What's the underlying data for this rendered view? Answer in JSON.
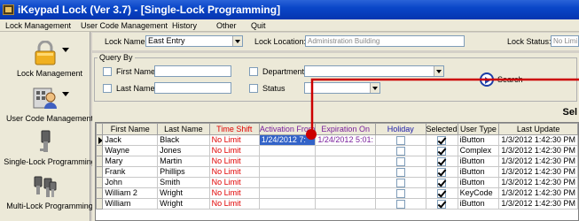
{
  "window": {
    "title": "iKeypad Lock (Ver 3.7) - [Single-Lock Programming]"
  },
  "menu": [
    "Lock Management",
    "User Code Management",
    "History",
    "Other",
    "Quit"
  ],
  "sidebar": {
    "items": [
      {
        "label": "Lock Management",
        "icon": "padlock-icon"
      },
      {
        "label": "User Code Management",
        "icon": "user-keypad-icon"
      },
      {
        "label": "Single-Lock Programming",
        "icon": "single-key-icon"
      },
      {
        "label": "Multi-Lock Programming",
        "icon": "multi-key-icon"
      }
    ]
  },
  "toprow": {
    "lock_name_label": "Lock Name:",
    "lock_name_value": "East Entry",
    "lock_location_label": "Lock Location:",
    "lock_location_value": "Administration Building",
    "lock_status_label": "Lock Status:",
    "lock_status_value": "No Limi"
  },
  "query": {
    "legend": "Query By",
    "first_name_label": "First Name",
    "last_name_label": "Last Name",
    "department_label": "Department",
    "status_label": "Status",
    "search_label": "Search"
  },
  "grid": {
    "caption": "Sel",
    "columns": [
      "First Name",
      "Last Name",
      "Time Shift",
      "Activation From",
      "Expiration On",
      "Holiday",
      "Selected",
      "User Type",
      "Last Update"
    ],
    "rows": [
      {
        "first": "Jack",
        "last": "Black",
        "shift": "No Limit",
        "from": "1/24/2012 7:",
        "to": "1/24/2012 5:01:",
        "holiday": false,
        "selected": true,
        "type": "iButton",
        "updated": "1/3/2012 1:42:30 PM",
        "current": true
      },
      {
        "first": "Wayne",
        "last": "Jones",
        "shift": "No Limit",
        "from": "",
        "to": "",
        "holiday": false,
        "selected": true,
        "type": "Complex",
        "updated": "1/3/2012 1:42:30 PM",
        "current": false
      },
      {
        "first": "Mary",
        "last": "Martin",
        "shift": "No Limit",
        "from": "",
        "to": "",
        "holiday": false,
        "selected": true,
        "type": "iButton",
        "updated": "1/3/2012 1:42:30 PM",
        "current": false
      },
      {
        "first": "Frank",
        "last": "Phillips",
        "shift": "No Limit",
        "from": "",
        "to": "",
        "holiday": false,
        "selected": true,
        "type": "iButton",
        "updated": "1/3/2012 1:42:30 PM",
        "current": false
      },
      {
        "first": "John",
        "last": "Smith",
        "shift": "No Limit",
        "from": "",
        "to": "",
        "holiday": false,
        "selected": true,
        "type": "iButton",
        "updated": "1/3/2012 1:42:30 PM",
        "current": false
      },
      {
        "first": "William 2",
        "last": "Wright",
        "shift": "No Limit",
        "from": "",
        "to": "",
        "holiday": false,
        "selected": true,
        "type": "KeyCode",
        "updated": "1/3/2012 1:42:30 PM",
        "current": false
      },
      {
        "first": "William",
        "last": "Wright",
        "shift": "No Limit",
        "from": "",
        "to": "",
        "holiday": false,
        "selected": true,
        "type": "iButton",
        "updated": "1/3/2012 1:42:30 PM",
        "current": false
      }
    ]
  },
  "colors": {
    "title_bar": "#0a46c8",
    "time_shift": "#e00000",
    "date_text": "#7a1f9c",
    "holiday_header": "#1a1aa8",
    "annotation": "#cc0000"
  }
}
